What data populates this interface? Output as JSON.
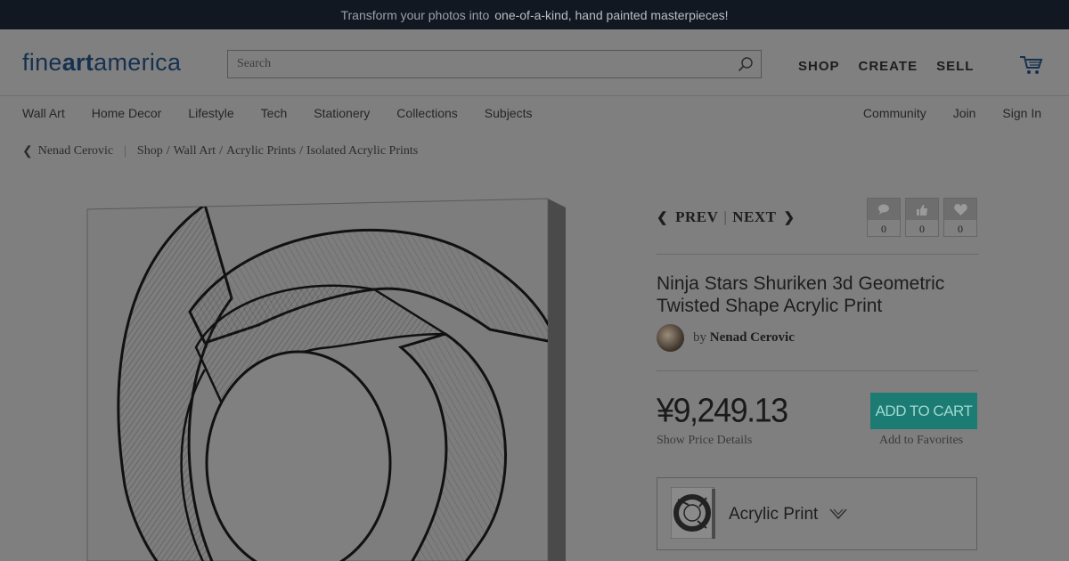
{
  "promo": {
    "prefix": "Transform your photos into",
    "highlight": "one-of-a-kind, hand painted masterpieces",
    "suffix": "!"
  },
  "header": {
    "logo": {
      "part1": "fine",
      "part2": "art",
      "part3": "america"
    },
    "search_placeholder": "Search",
    "nav": [
      "SHOP",
      "CREATE",
      "SELL"
    ]
  },
  "subnav": {
    "left": [
      "Wall Art",
      "Home Decor",
      "Lifestyle",
      "Tech",
      "Stationery",
      "Collections",
      "Subjects"
    ],
    "right": [
      "Community",
      "Join",
      "Sign In"
    ]
  },
  "breadcrumb": {
    "artist": "Nenad Cerovic",
    "separator": "|",
    "path": [
      "Shop",
      "Wall Art",
      "Acrylic Prints",
      "Isolated Acrylic Prints"
    ]
  },
  "pager": {
    "prev": "PREV",
    "divider": "|",
    "next": "NEXT"
  },
  "stats": [
    {
      "icon": "comment-icon",
      "count": "0"
    },
    {
      "icon": "thumbs-up-icon",
      "count": "0"
    },
    {
      "icon": "heart-icon",
      "count": "0"
    }
  ],
  "product": {
    "title": "Ninja Stars Shuriken 3d Geometric Twisted Shape Acrylic Print",
    "by": "by",
    "artist": "Nenad Cerovic",
    "price": "¥9,249.13",
    "price_details": "Show Price Details",
    "add_to_cart": "ADD TO CART",
    "add_to_favorites": "Add to Favorites",
    "type_label": "Acrylic Print"
  },
  "colors": {
    "promo_bg": "#121821",
    "button_bg": "#1c7b72",
    "overlay": "#7f7f7f"
  }
}
